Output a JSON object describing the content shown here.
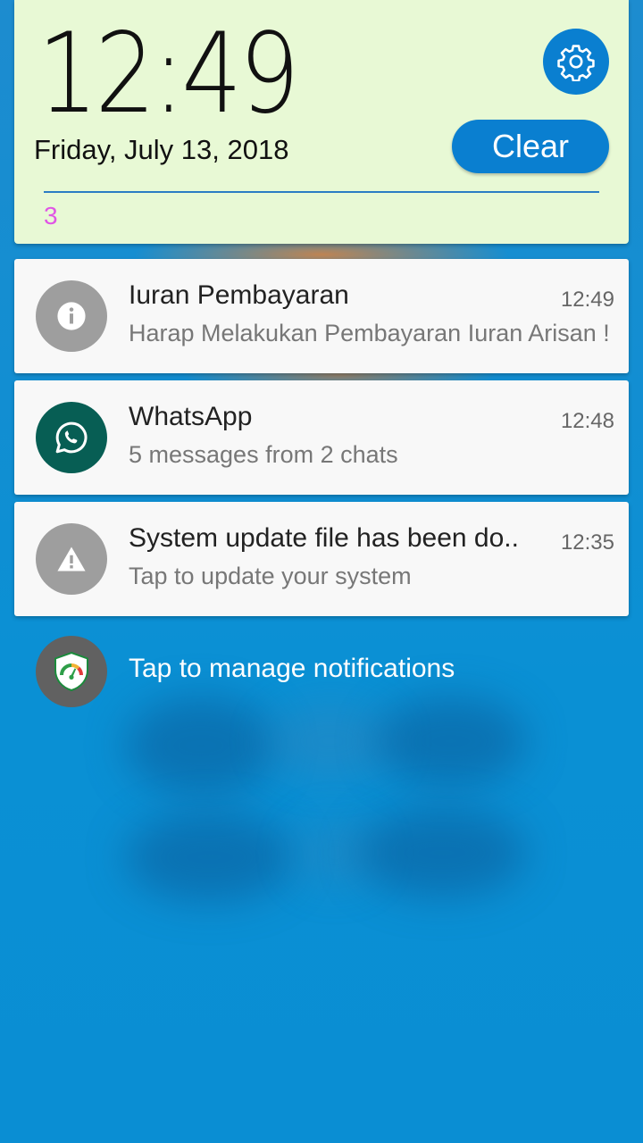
{
  "header": {
    "time": "12:49",
    "date": "Friday, July 13, 2018",
    "clear_label": "Clear",
    "notification_count": "3"
  },
  "notifications": [
    {
      "title": "Iuran Pembayaran",
      "body": "Harap Melakukan Pembayaran Iuran Arisan !",
      "time": "12:49",
      "icon": "info-icon",
      "icon_color": "#9e9e9e"
    },
    {
      "title": "WhatsApp",
      "body": "5 messages from 2 chats",
      "time": "12:48",
      "icon": "whatsapp-icon",
      "icon_color": "#075e54"
    },
    {
      "title": "System update file has been do..",
      "body": "Tap to update your system",
      "time": "12:35",
      "icon": "warning-icon",
      "icon_color": "#9e9e9e"
    }
  ],
  "manage": {
    "label": "Tap to manage notifications",
    "icon": "shield-speedometer-icon"
  },
  "colors": {
    "accent": "#0a7fd0",
    "header_bg": "#e8f9d5",
    "count_color": "#e056e5",
    "background": "#0a8fd2"
  }
}
